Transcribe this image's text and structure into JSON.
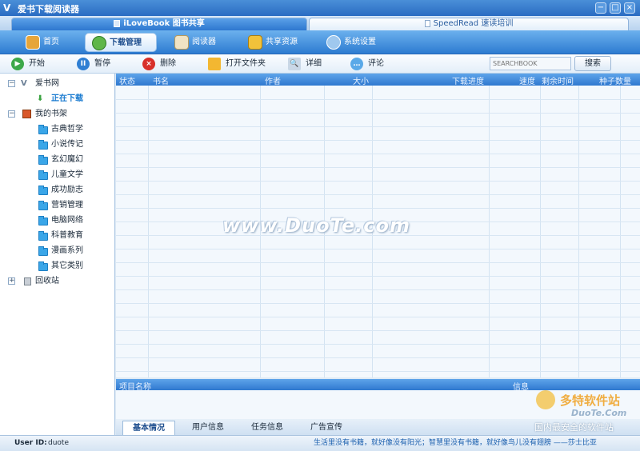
{
  "app": {
    "title": "爱书下载阅读器"
  },
  "window_buttons": [
    "−",
    "□",
    "×"
  ],
  "top_tabs": [
    {
      "label": "iLoveBook 图书共享"
    },
    {
      "label": "SpeedRead 速读培训"
    }
  ],
  "nav": [
    {
      "label": "首页",
      "icon": "home-icon"
    },
    {
      "label": "下载管理",
      "icon": "download-manager-icon"
    },
    {
      "label": "阅读器",
      "icon": "reader-icon"
    },
    {
      "label": "共享资源",
      "icon": "shared-resources-icon"
    },
    {
      "label": "系统设置",
      "icon": "settings-icon"
    }
  ],
  "toolbar": {
    "start": "开始",
    "pause": "暂停",
    "delete": "删除",
    "open_folder": "打开文件夹",
    "details": "详细",
    "comment": "评论"
  },
  "search": {
    "placeholder": "SEARCHBOOK",
    "button": "搜索"
  },
  "tree": {
    "root": "爱书网",
    "downloading": "正在下载",
    "bookshelf": "我的书架",
    "categories": [
      "古典哲学",
      "小说传记",
      "玄幻魔幻",
      "儿童文学",
      "成功励志",
      "营销管理",
      "电脑网络",
      "科普教育",
      "漫画系列",
      "其它类别"
    ],
    "recycle": "回收站"
  },
  "grid": {
    "columns": [
      "状态",
      "书名",
      "作者",
      "大小",
      "下载进度",
      "速度",
      "剩余时间",
      "种子数量"
    ],
    "rows": []
  },
  "info": {
    "left": "项目名称",
    "right": "信息"
  },
  "bottom_tabs": [
    "基本情况",
    "用户信息",
    "任务信息",
    "广告宣传"
  ],
  "status": {
    "user_label": "User ID:",
    "user_value": "duote",
    "quote": "生活里没有书籍，就好像没有阳光；智慧里没有书籍，就好像鸟儿没有翅膀 ——莎士比亚"
  },
  "watermark": "www.DuoTe.com",
  "brand": {
    "name": "多特软件站",
    "url": "DuoTe.Com",
    "slogan": "国内最安全的软件站"
  },
  "colors": {
    "accent": "#2f78cf",
    "active_text": "#1f4f8f",
    "link": "#1a7bd0"
  }
}
